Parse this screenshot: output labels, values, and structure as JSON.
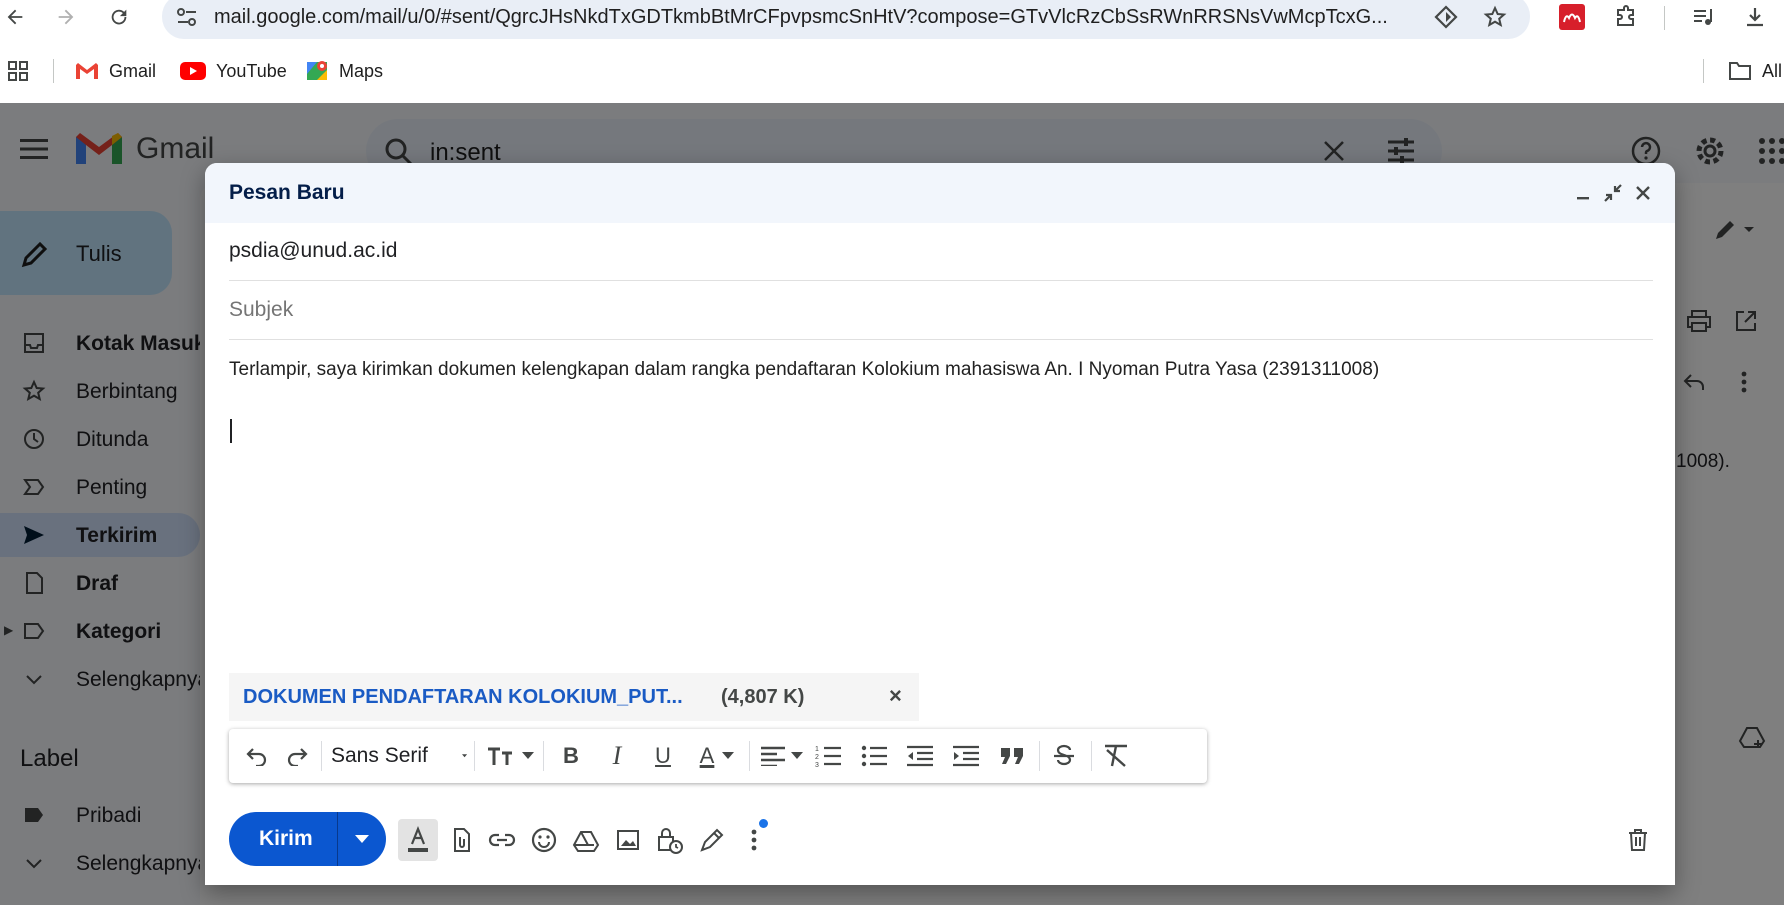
{
  "browser": {
    "url": "mail.google.com/mail/u/0/#sent/QgrcJHsNkdTxGDTkmbBtMrCFpvpsmcSnHtV?compose=GTvVlcRzCbSsRWnRRSNsVwMcpTcxG...",
    "bookmarks": [
      "Gmail",
      "YouTube",
      "Maps"
    ],
    "all_bookmarks_label": "All"
  },
  "gmail": {
    "logo_text": "Gmail",
    "search_query": "in:sent",
    "compose_label": "Tulis",
    "sidebar": [
      {
        "label": "Kotak Masuk",
        "icon": "inbox-icon",
        "bold": true
      },
      {
        "label": "Berbintang",
        "icon": "star-icon",
        "bold": false
      },
      {
        "label": "Ditunda",
        "icon": "clock-icon",
        "bold": false
      },
      {
        "label": "Penting",
        "icon": "label-important-icon",
        "bold": false
      },
      {
        "label": "Terkirim",
        "icon": "send-icon",
        "bold": true
      },
      {
        "label": "Draf",
        "icon": "draft-icon",
        "bold": true
      },
      {
        "label": "Kategori",
        "icon": "label-icon",
        "bold": true
      },
      {
        "label": "Selengkapnya",
        "icon": "chevron-down-icon",
        "bold": false
      }
    ],
    "labels_heading": "Label",
    "labels": [
      {
        "label": "Pribadi",
        "icon": "label-filled-icon"
      },
      {
        "label": "Selengkapnya",
        "icon": "chevron-down-icon"
      }
    ],
    "background_snippet": "1008)."
  },
  "compose": {
    "title": "Pesan Baru",
    "to": "psdia@unud.ac.id",
    "subject_placeholder": "Subjek",
    "body": "Terlampir, saya kirimkan dokumen kelengkapan dalam rangka pendaftaran Kolokium mahasiswa An. I Nyoman Putra Yasa (2391311008)",
    "attachment": {
      "name": "DOKUMEN PENDAFTARAN KOLOKIUM_PUT...",
      "size": "(4,807 K)"
    },
    "font_name": "Sans Serif",
    "send_label": "Kirim"
  },
  "colors": {
    "send_blue": "#0b57d0",
    "attachment_blue": "#1a5bc4",
    "header_bg": "#f2f6fc",
    "sent_highlight": "#d3e3fd"
  }
}
